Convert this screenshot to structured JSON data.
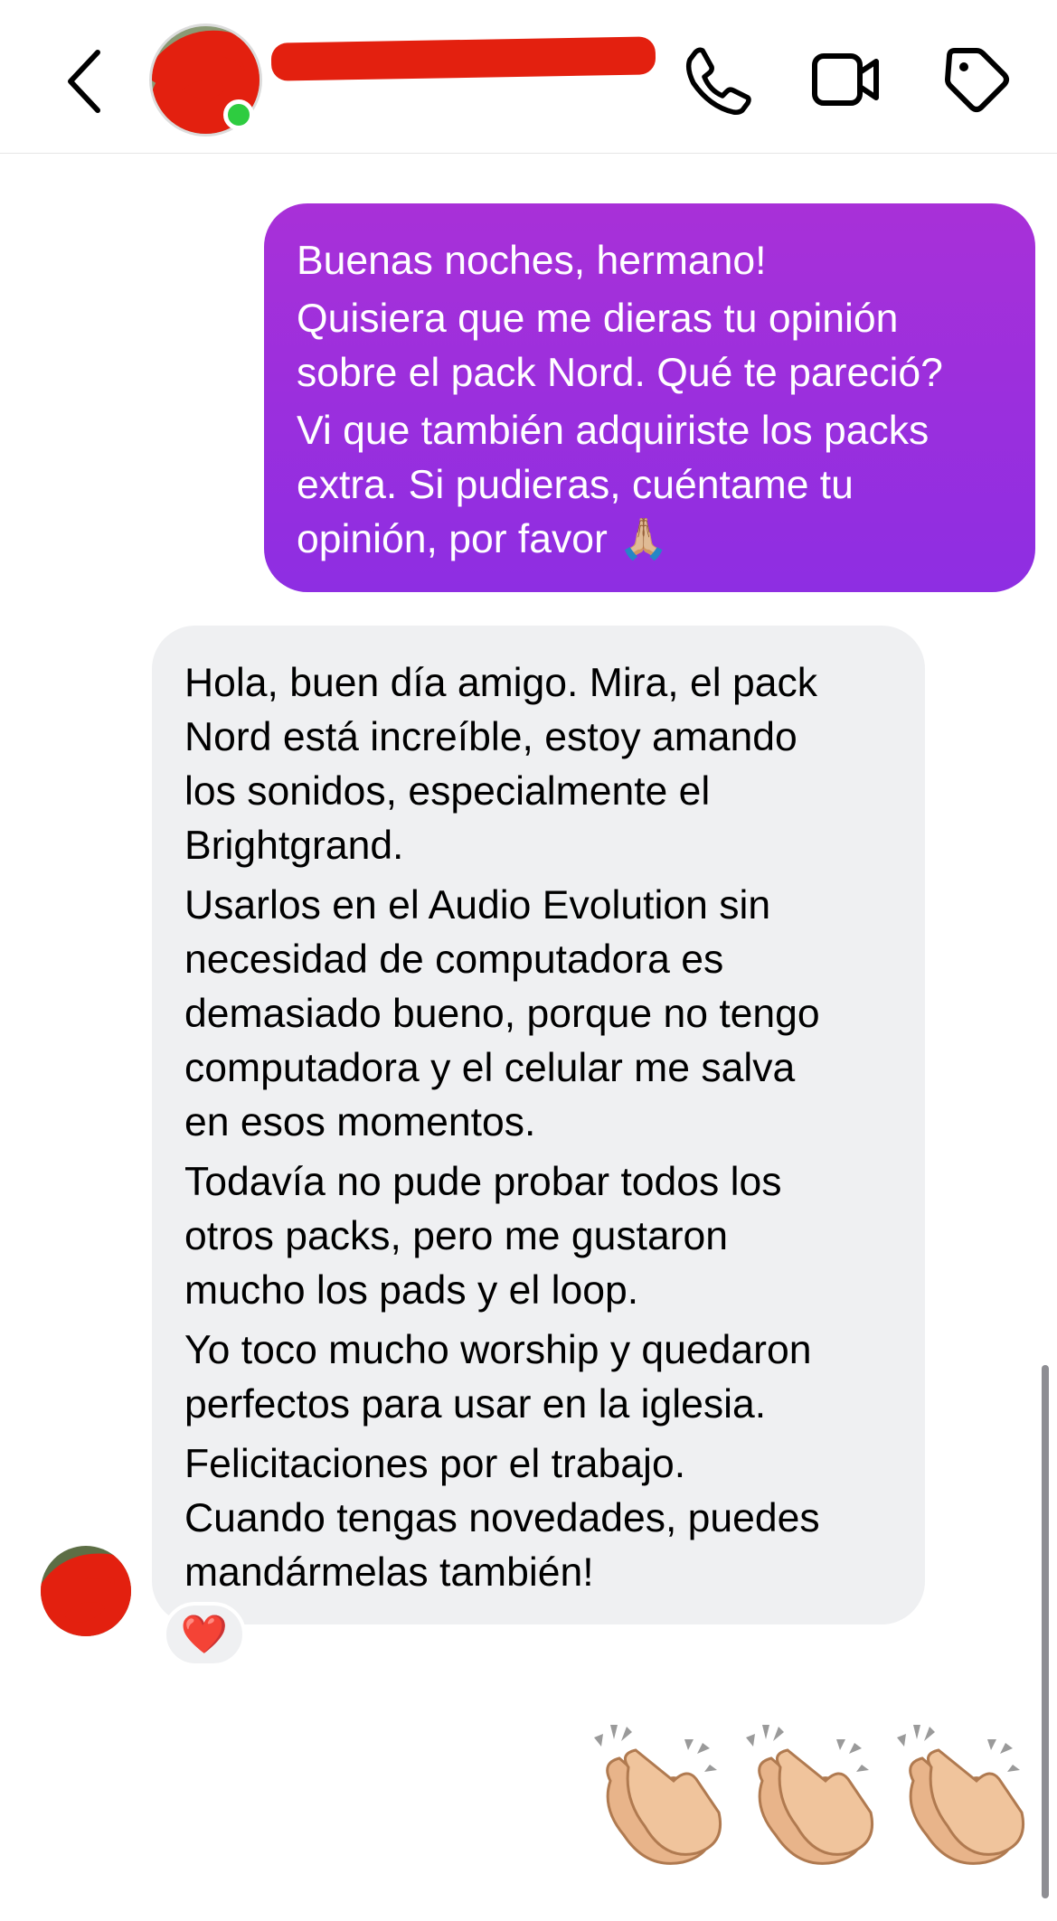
{
  "header": {
    "contact_name": "",
    "status": "online"
  },
  "messages": [
    {
      "direction": "outgoing",
      "paragraphs": [
        [
          "Buenas noches, hermano!"
        ],
        [
          "Quisiera que me dieras tu opinión",
          "sobre el pack Nord. Qué te pareció?"
        ],
        [
          "Vi que también adquiriste los packs",
          "extra. Si pudieras, cuéntame tu",
          "opinión, por favor 🙏🏼"
        ]
      ]
    },
    {
      "direction": "incoming",
      "paragraphs": [
        [
          "Hola, buen día amigo. Mira, el pack",
          "Nord está increíble, estoy amando",
          "los sonidos, especialmente el",
          "Brightgrand."
        ],
        [
          "Usarlos en el Audio Evolution sin",
          "necesidad de computadora es",
          "demasiado bueno, porque no tengo",
          "computadora y el celular me salva",
          "en esos momentos."
        ],
        [
          "Todavía no pude probar todos los",
          "otros packs, pero me gustaron",
          "mucho los pads y el loop."
        ],
        [
          "Yo toco mucho worship y quedaron",
          "perfectos para usar en la iglesia."
        ],
        [
          "Felicitaciones por el trabajo.",
          "Cuando tengas novedades, puedes",
          "mandármelas también!"
        ]
      ],
      "reaction": "❤️"
    },
    {
      "direction": "outgoing",
      "emoji": "👏🏼👏🏼👏🏼",
      "count": 3
    }
  ],
  "colors": {
    "outgoing_bubble_top": "#a830d8",
    "outgoing_bubble_bottom": "#8e2ee2",
    "incoming_bubble": "#eff0f2",
    "online_dot": "#2ecc40",
    "redaction": "#e3200f"
  },
  "icons": {
    "back": "chevron-left-icon",
    "call": "phone-icon",
    "video": "video-camera-icon",
    "tag": "tag-icon",
    "reaction": "heart-icon",
    "clap": "clapping-hands-icon"
  }
}
